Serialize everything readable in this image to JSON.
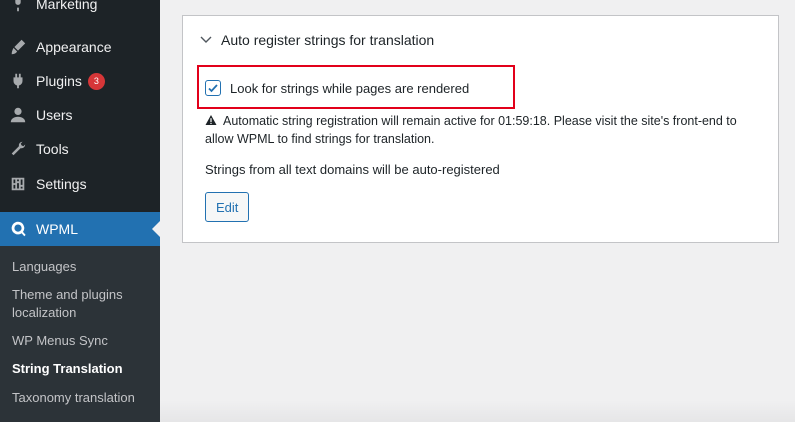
{
  "sidebar": {
    "items": [
      {
        "label": "Marketing",
        "icon": "marketing-icon"
      },
      {
        "label": "Appearance",
        "icon": "brush-icon"
      },
      {
        "label": "Plugins",
        "icon": "plugin-icon",
        "badge": "3"
      },
      {
        "label": "Users",
        "icon": "user-icon"
      },
      {
        "label": "Tools",
        "icon": "wrench-icon"
      },
      {
        "label": "Settings",
        "icon": "settings-icon"
      },
      {
        "label": "WPML",
        "icon": "wpml-icon"
      }
    ],
    "submenu": [
      {
        "label": "Languages"
      },
      {
        "label": "Theme and plugins localization"
      },
      {
        "label": "WP Menus Sync"
      },
      {
        "label": "String Translation"
      },
      {
        "label": "Taxonomy translation"
      }
    ]
  },
  "panel": {
    "title": "Auto register strings for translation",
    "checkbox_label": "Look for strings while pages are rendered",
    "checkbox_checked": true,
    "warning": "Automatic string registration will remain active for 01:59:18. Please visit the site's front-end to allow WPML to find strings for translation.",
    "domains_text": "Strings from all text domains will be auto-registered",
    "edit_label": "Edit"
  },
  "colors": {
    "sidebar_bg": "#1d2327",
    "accent": "#2271b1",
    "highlight": "#e2001a",
    "badge": "#d63638"
  }
}
